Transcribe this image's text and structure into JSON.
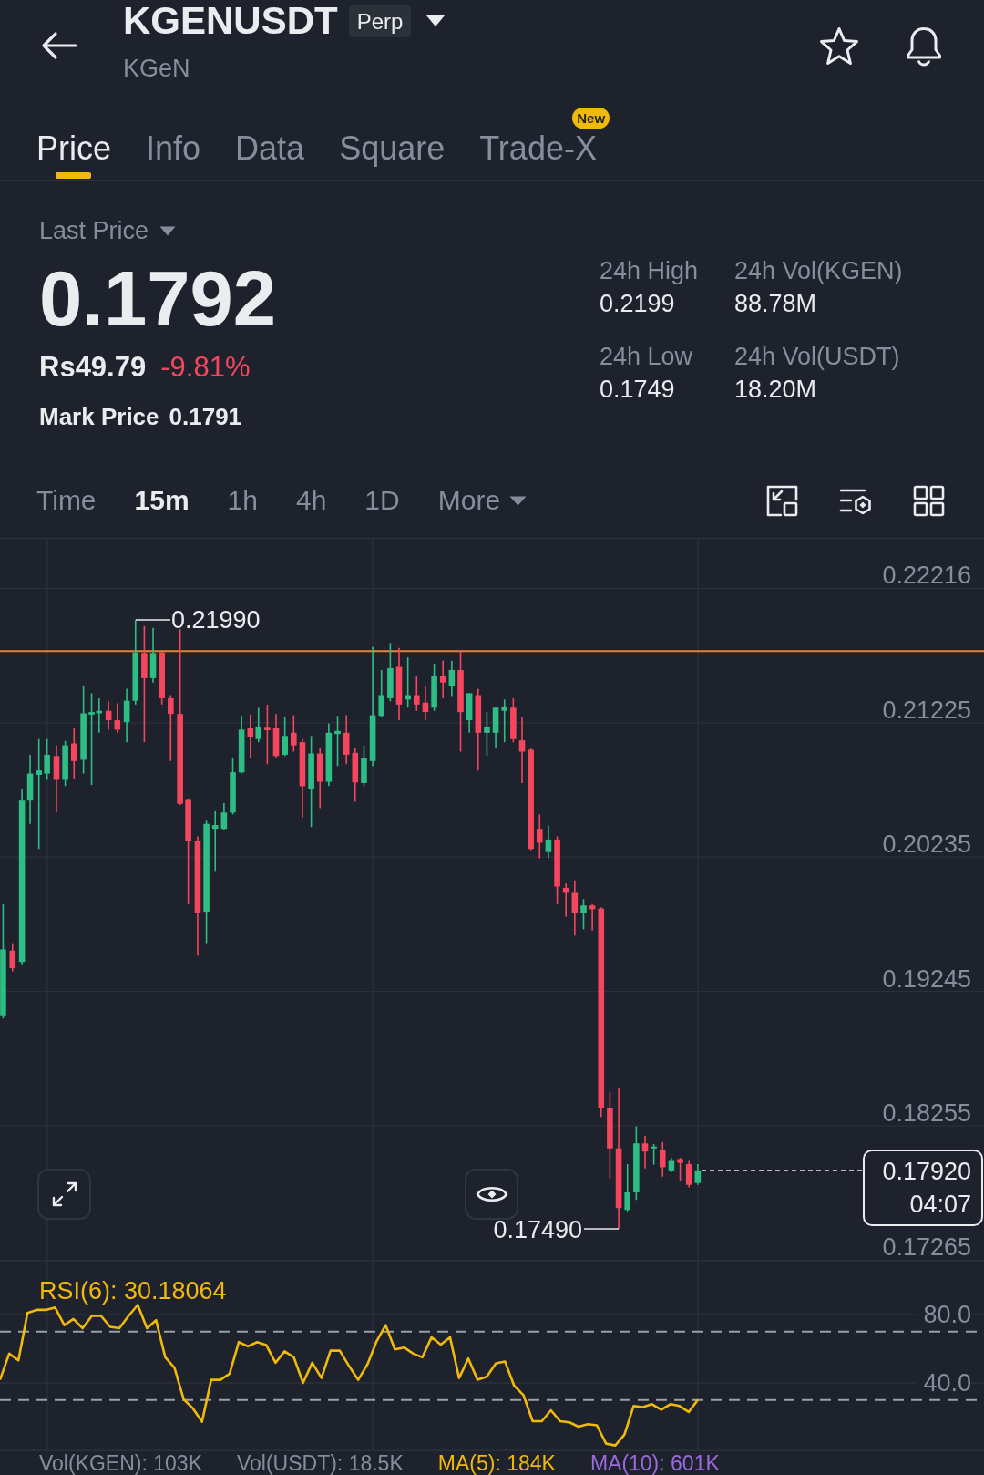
{
  "header": {
    "symbol": "KGENUSDT",
    "contract_badge": "Perp",
    "subtitle": "KGeN"
  },
  "tabs": [
    {
      "label": "Price",
      "selected": true
    },
    {
      "label": "Info",
      "selected": false
    },
    {
      "label": "Data",
      "selected": false
    },
    {
      "label": "Square",
      "selected": false
    },
    {
      "label": "Trade-X",
      "selected": false,
      "badge": "New"
    }
  ],
  "price": {
    "selector": "Last Price",
    "last": "0.1792",
    "fiat": "Rs49.79",
    "change": "-9.81%",
    "mark_label": "Mark Price",
    "mark_value": "0.1791"
  },
  "stats": [
    {
      "label": "24h High",
      "value": "0.2199"
    },
    {
      "label": "24h Vol(KGEN)",
      "value": "88.78M"
    },
    {
      "label": "24h Low",
      "value": "0.1749"
    },
    {
      "label": "24h Vol(USDT)",
      "value": "18.20M"
    }
  ],
  "intervals": [
    {
      "label": "Time",
      "selected": false,
      "kind": "option"
    },
    {
      "label": "15m",
      "selected": true,
      "kind": "option"
    },
    {
      "label": "1h",
      "selected": false,
      "kind": "option"
    },
    {
      "label": "4h",
      "selected": false,
      "kind": "option"
    },
    {
      "label": "1D",
      "selected": false,
      "kind": "option"
    },
    {
      "label": "More",
      "selected": false,
      "kind": "dropdown"
    }
  ],
  "chart": {
    "price_axis": [
      "0.22216",
      "0.21225",
      "0.20235",
      "0.19245",
      "0.18255",
      "0.17265"
    ],
    "high_marker": "0.21990",
    "low_marker": "0.17490",
    "last_price_tag": {
      "price": "0.17920",
      "countdown": "04:07"
    }
  },
  "rsi": {
    "chart_data": {
      "type": "line",
      "title": "RSI(6): 30.18064",
      "ylim": [
        0,
        112
      ],
      "yticks": [
        {
          "value": 80,
          "label": "80.0"
        },
        {
          "value": 40,
          "label": "40.0"
        }
      ],
      "grid": true,
      "ref_lines": [
        {
          "axis": "y",
          "value": 70
        },
        {
          "axis": "y",
          "value": 30
        }
      ],
      "series": [
        {
          "color": "#f0b90b",
          "values": [
            41.8,
            57.1,
            53.2,
            80.9,
            82.7,
            82.7,
            84.1,
            73.8,
            77.4,
            72.0,
            79.2,
            79.2,
            72.8,
            72.0,
            79.2,
            85.6,
            72.0,
            76.7,
            55.0,
            48.9,
            30.4,
            25.1,
            17.3,
            41.8,
            41.8,
            45.4,
            63.9,
            61.4,
            63.9,
            62.1,
            51.8,
            58.5,
            55.0,
            40.0,
            51.8,
            42.9,
            58.9,
            58.9,
            50.0,
            41.8,
            50.7,
            64.2,
            73.8,
            59.6,
            60.7,
            57.1,
            55.0,
            66.7,
            62.4,
            66.7,
            42.9,
            54.3,
            41.8,
            43.6,
            51.4,
            52.5,
            38.3,
            32.9,
            17.6,
            17.6,
            24.0,
            17.6,
            16.9,
            14.4,
            15.9,
            15.2,
            4.5,
            3.4,
            9.8,
            26.5,
            25.8,
            27.6,
            24.4,
            27.6,
            26.5,
            23.0,
            30.2
          ]
        }
      ]
    }
  },
  "volume_legend": [
    {
      "label": "Vol(KGEN): 103K",
      "color": "#848e9c"
    },
    {
      "label": "Vol(USDT): 18.5K",
      "color": "#848e9c"
    },
    {
      "label": "MA(5): 184K",
      "color": "#f0b90b"
    },
    {
      "label": "MA(10): 601K",
      "color": "#9c6ade"
    }
  ]
}
